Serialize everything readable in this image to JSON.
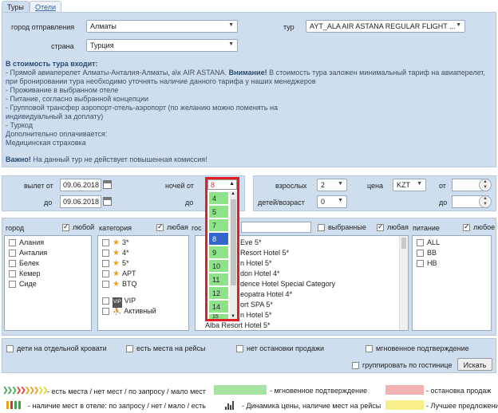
{
  "tabs": {
    "tours": "Туры",
    "hotels": "Отели"
  },
  "search": {
    "departure_city_label": "город отправления",
    "departure_city_value": "Алматы",
    "country_label": "страна",
    "country_value": "Турция",
    "tour_label": "тур",
    "tour_value": "AYT_ALA AIR ASTANA REGULAR FLIGHT ..."
  },
  "info": {
    "heading": "В стоимость тура входит:",
    "line1_plain": "- Прямой авиаперелет Алматы-Анталия-Алматы, а\\к AIR ASTANA.",
    "line1_bold": "Внимание!",
    "line1_rest": " В стоимость тура заложен минимальный тариф  на авиаперелет,",
    "line2": "при бронировании тура необходимо уточнять  наличие данного тарифа у наших менеджеров",
    "line3": "- Проживание в выбранном отеле",
    "line4": "- Питание, согласно выбранной концепции",
    "line5": "- Групповой трансфер аэропорт-отель-аэропорт (по желанию можно поменять на",
    "line6": "индивидуальный за доплату)",
    "line7": "- Туркод",
    "line8": "Дополнительно оплачивается:",
    "line9": " Медицинская страховка",
    "warn_bold": "Важно!",
    "warn_rest": " На данный тур  не действует повышенная комиссия!"
  },
  "dates": {
    "departure_from_label": "вылет от",
    "departure_from_value": "09.06.2018",
    "to_label": "до",
    "to_value": "09.06.2018",
    "nights_from_label": "ночей от",
    "nights_to_label": "до",
    "nights_selected": "8",
    "nights_options": [
      "4",
      "5",
      "7",
      "8",
      "9",
      "10",
      "11",
      "12",
      "14",
      "15"
    ],
    "nights_highlighted": "8"
  },
  "tourists": {
    "adults_label": "взрослых",
    "adults_value": "2",
    "children_label": "детей/возраст",
    "children_value": "0",
    "price_label": "цена",
    "currency_value": "KZT",
    "from_label": "от",
    "to_label": "до"
  },
  "filters": {
    "city_label": "город",
    "city_any": "любой",
    "cities": [
      "Алания",
      "Анталия",
      "Белек",
      "Кемер",
      "Сиде"
    ],
    "category_label": "категория",
    "category_any": "любая",
    "categories": [
      "3*",
      "4*",
      "5*",
      "APT",
      "BTQ",
      "VIP",
      "Активный"
    ],
    "hotel_label": "гос",
    "hotels": [
      "Eve 5*",
      "Resort Hotel 5*",
      "n Hotel 5*",
      "don Hotel 4*",
      "dence Hotel Special Category",
      "eopatra Hotel 4*",
      "ort SPA 5*",
      "n Hotel 5*",
      "Alba Resort Hotel 5*"
    ],
    "selected_label": "выбранные",
    "any_fem": "любая",
    "meal_label": "питание",
    "meal_any": "любое",
    "meals": [
      "ALL",
      "BB",
      "HB"
    ]
  },
  "options": {
    "child_bed": "дети на отдельной кровати",
    "seats": "есть места на рейсы",
    "no_stop": "нет остановки продажи",
    "instant": "мгновенное подтверждение",
    "group": "группировать по гостинице",
    "search_button": "Искать"
  },
  "legend": {
    "availability": "- есть места / нет мест / по запросу / мало мест",
    "instant": "- мгновенное подтверждение",
    "stop": "- остановка продаж",
    "hotel_avail": "- наличие мест в отеле: по запросу / нет / мало / есть",
    "dynamics": "- Динамика цены, наличие мест на рейсы",
    "best": "- Лучшее предложение"
  },
  "colors": {
    "panel": "#cfdeef",
    "green": "#a6e3a2",
    "red": "#f2b2b2",
    "yellow": "#f7ee8a",
    "dropdown_border": "#e31f26"
  }
}
